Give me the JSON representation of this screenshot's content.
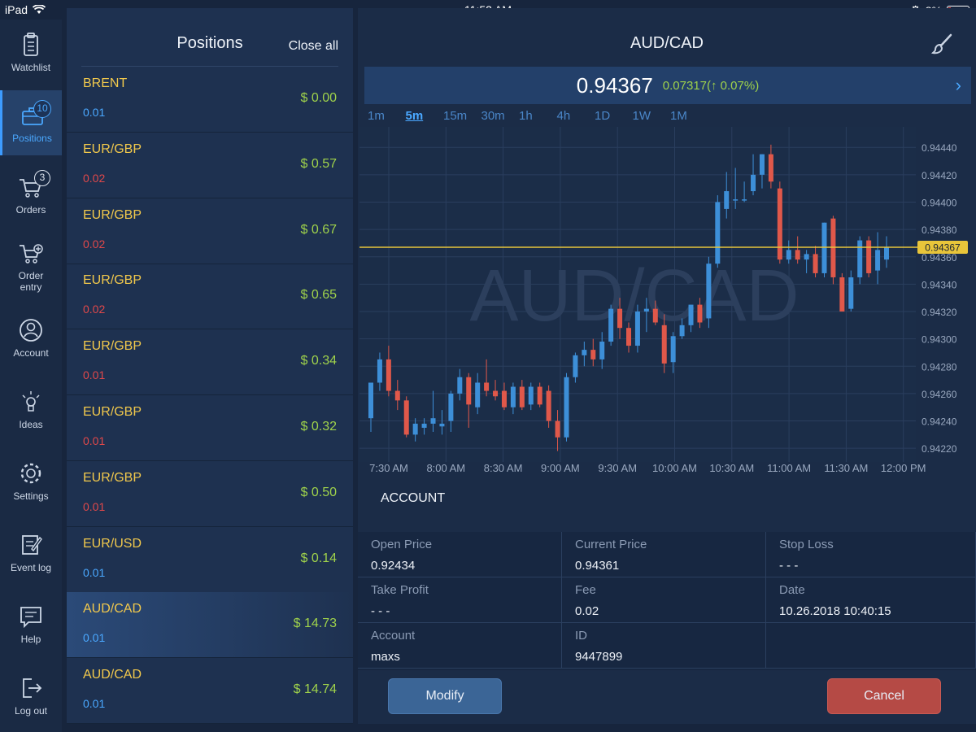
{
  "status": {
    "device": "iPad",
    "time": "11:52 AM",
    "battery": "8%"
  },
  "nav": [
    {
      "label": "Watchlist",
      "icon": "clipboard-icon"
    },
    {
      "label": "Positions",
      "icon": "briefcase-icon",
      "badge": "10"
    },
    {
      "label": "Orders",
      "icon": "cart-icon",
      "badge": "3"
    },
    {
      "label": "Order\nentry",
      "icon": "cart-plus-icon"
    },
    {
      "label": "Account",
      "icon": "user-icon"
    },
    {
      "label": "Ideas",
      "icon": "lightbulb-icon"
    },
    {
      "label": "Settings",
      "icon": "gear-icon"
    },
    {
      "label": "Event log",
      "icon": "edit-log-icon"
    },
    {
      "label": "Help",
      "icon": "chat-bubble-icon"
    },
    {
      "label": "Log out",
      "icon": "logout-icon"
    }
  ],
  "positions": {
    "title": "Positions",
    "close_all": "Close all",
    "rows": [
      {
        "symbol": "BRENT",
        "qty": "0.01",
        "qty_color": "#4aa8ff",
        "pnl": "$ 0.00"
      },
      {
        "symbol": "EUR/GBP",
        "qty": "0.02",
        "qty_color": "#e0484a",
        "pnl": "$ 0.57"
      },
      {
        "symbol": "EUR/GBP",
        "qty": "0.02",
        "qty_color": "#e0484a",
        "pnl": "$ 0.67"
      },
      {
        "symbol": "EUR/GBP",
        "qty": "0.02",
        "qty_color": "#e0484a",
        "pnl": "$ 0.65"
      },
      {
        "symbol": "EUR/GBP",
        "qty": "0.01",
        "qty_color": "#e0484a",
        "pnl": "$ 0.34"
      },
      {
        "symbol": "EUR/GBP",
        "qty": "0.01",
        "qty_color": "#e0484a",
        "pnl": "$ 0.32"
      },
      {
        "symbol": "EUR/GBP",
        "qty": "0.01",
        "qty_color": "#e0484a",
        "pnl": "$ 0.50"
      },
      {
        "symbol": "EUR/USD",
        "qty": "0.01",
        "qty_color": "#4aa8ff",
        "pnl": "$ 0.14"
      },
      {
        "symbol": "AUD/CAD",
        "qty": "0.01",
        "qty_color": "#4aa8ff",
        "pnl": "$ 14.73",
        "selected": true
      },
      {
        "symbol": "AUD/CAD",
        "qty": "0.01",
        "qty_color": "#4aa8ff",
        "pnl": "$ 14.74"
      }
    ]
  },
  "main": {
    "symbol": "AUD/CAD",
    "price": "0.94367",
    "change": "0.07317(↑ 0.07%)",
    "timeframes": [
      "1m",
      "5m",
      "15m",
      "30m",
      "1h",
      "4h",
      "1D",
      "1W",
      "1M"
    ],
    "active_timeframe": "5m",
    "account_title": "ACCOUNT",
    "details": [
      {
        "label": "Open Price",
        "value": "0.92434"
      },
      {
        "label": "Current Price",
        "value": "0.94361"
      },
      {
        "label": "Stop Loss",
        "value": "- - -"
      },
      {
        "label": "Take Profit",
        "value": "- - -"
      },
      {
        "label": "Fee",
        "value": "0.02"
      },
      {
        "label": "Date",
        "value": "10.26.2018 10:40:15"
      },
      {
        "label": "Account",
        "value": "maxs"
      },
      {
        "label": "ID",
        "value": "9447899"
      },
      {
        "label": "",
        "value": ""
      }
    ],
    "modify_label": "Modify",
    "cancel_label": "Cancel"
  },
  "chart_data": {
    "type": "candlestick",
    "watermark": "AUD/CAD",
    "x_ticks": [
      "7:30 AM",
      "8:00 AM",
      "8:30 AM",
      "9:00 AM",
      "9:30 AM",
      "10:00 AM",
      "10:30 AM",
      "11:00 AM",
      "11:30 AM",
      "12:00 PM"
    ],
    "y_ticks": [
      "0.94440",
      "0.94420",
      "0.94400",
      "0.94380",
      "0.94360",
      "0.94340",
      "0.94320",
      "0.94300",
      "0.94280",
      "0.94260",
      "0.94240",
      "0.94220"
    ],
    "ylim": [
      0.9421,
      0.94455
    ],
    "current_price_label": "0.94367",
    "current_price": 0.94367,
    "up_color": "#3d8fd8",
    "down_color": "#e0584a",
    "grid": true,
    "candles": [
      {
        "o": 0.94242,
        "h": 0.94262,
        "l": 0.94232,
        "c": 0.94268
      },
      {
        "o": 0.94268,
        "h": 0.9429,
        "l": 0.94262,
        "c": 0.94285
      },
      {
        "o": 0.94285,
        "h": 0.94295,
        "l": 0.94258,
        "c": 0.94262
      },
      {
        "o": 0.94262,
        "h": 0.9427,
        "l": 0.94248,
        "c": 0.94255
      },
      {
        "o": 0.94255,
        "h": 0.94258,
        "l": 0.94228,
        "c": 0.9423
      },
      {
        "o": 0.9423,
        "h": 0.94242,
        "l": 0.94225,
        "c": 0.94238
      },
      {
        "o": 0.94235,
        "h": 0.94242,
        "l": 0.9423,
        "c": 0.94238
      },
      {
        "o": 0.94238,
        "h": 0.94262,
        "l": 0.94232,
        "c": 0.94242
      },
      {
        "o": 0.94236,
        "h": 0.94248,
        "l": 0.9423,
        "c": 0.94238
      },
      {
        "o": 0.9424,
        "h": 0.94262,
        "l": 0.94232,
        "c": 0.9426
      },
      {
        "o": 0.9426,
        "h": 0.94278,
        "l": 0.94255,
        "c": 0.94272
      },
      {
        "o": 0.94272,
        "h": 0.94275,
        "l": 0.94235,
        "c": 0.94252
      },
      {
        "o": 0.9425,
        "h": 0.94275,
        "l": 0.94245,
        "c": 0.94268
      },
      {
        "o": 0.94268,
        "h": 0.94285,
        "l": 0.94258,
        "c": 0.94262
      },
      {
        "o": 0.94262,
        "h": 0.9427,
        "l": 0.94255,
        "c": 0.94258
      },
      {
        "o": 0.94262,
        "h": 0.94268,
        "l": 0.94248,
        "c": 0.9425
      },
      {
        "o": 0.9425,
        "h": 0.94268,
        "l": 0.94245,
        "c": 0.94265
      },
      {
        "o": 0.94265,
        "h": 0.9427,
        "l": 0.94248,
        "c": 0.9425
      },
      {
        "o": 0.94252,
        "h": 0.94268,
        "l": 0.94248,
        "c": 0.94265
      },
      {
        "o": 0.94265,
        "h": 0.94268,
        "l": 0.9425,
        "c": 0.94252
      },
      {
        "o": 0.94262,
        "h": 0.94266,
        "l": 0.94235,
        "c": 0.9424
      },
      {
        "o": 0.9424,
        "h": 0.94248,
        "l": 0.94218,
        "c": 0.94228
      },
      {
        "o": 0.94228,
        "h": 0.94275,
        "l": 0.94225,
        "c": 0.94272
      },
      {
        "o": 0.94272,
        "h": 0.9429,
        "l": 0.94268,
        "c": 0.94288
      },
      {
        "o": 0.94288,
        "h": 0.94298,
        "l": 0.9428,
        "c": 0.94292
      },
      {
        "o": 0.94292,
        "h": 0.943,
        "l": 0.9428,
        "c": 0.94285
      },
      {
        "o": 0.94285,
        "h": 0.94305,
        "l": 0.94278,
        "c": 0.94298
      },
      {
        "o": 0.94298,
        "h": 0.94325,
        "l": 0.94295,
        "c": 0.94322
      },
      {
        "o": 0.94322,
        "h": 0.9433,
        "l": 0.943,
        "c": 0.94308
      },
      {
        "o": 0.94308,
        "h": 0.94312,
        "l": 0.9429,
        "c": 0.94295
      },
      {
        "o": 0.94295,
        "h": 0.94325,
        "l": 0.9429,
        "c": 0.9432
      },
      {
        "o": 0.9432,
        "h": 0.9433,
        "l": 0.94305,
        "c": 0.94322
      },
      {
        "o": 0.94322,
        "h": 0.94328,
        "l": 0.9431,
        "c": 0.94312
      },
      {
        "o": 0.9431,
        "h": 0.94318,
        "l": 0.94275,
        "c": 0.94282
      },
      {
        "o": 0.94283,
        "h": 0.94305,
        "l": 0.94275,
        "c": 0.94302
      },
      {
        "o": 0.94302,
        "h": 0.94315,
        "l": 0.943,
        "c": 0.9431
      },
      {
        "o": 0.9431,
        "h": 0.94325,
        "l": 0.94305,
        "c": 0.94325
      },
      {
        "o": 0.94325,
        "h": 0.9433,
        "l": 0.94308,
        "c": 0.94312
      },
      {
        "o": 0.94315,
        "h": 0.9436,
        "l": 0.94308,
        "c": 0.94355
      },
      {
        "o": 0.94355,
        "h": 0.94405,
        "l": 0.94352,
        "c": 0.944
      },
      {
        "o": 0.94395,
        "h": 0.94422,
        "l": 0.94388,
        "c": 0.94408
      },
      {
        "o": 0.94402,
        "h": 0.94425,
        "l": 0.94395,
        "c": 0.94402
      },
      {
        "o": 0.94402,
        "h": 0.94415,
        "l": 0.944,
        "c": 0.94402
      },
      {
        "o": 0.94408,
        "h": 0.94435,
        "l": 0.94405,
        "c": 0.9442
      },
      {
        "o": 0.9442,
        "h": 0.94435,
        "l": 0.9441,
        "c": 0.94435
      },
      {
        "o": 0.94435,
        "h": 0.94442,
        "l": 0.9441,
        "c": 0.94415
      },
      {
        "o": 0.9441,
        "h": 0.94415,
        "l": 0.94355,
        "c": 0.94358
      },
      {
        "o": 0.94358,
        "h": 0.94372,
        "l": 0.94355,
        "c": 0.94365
      },
      {
        "o": 0.94365,
        "h": 0.94375,
        "l": 0.94355,
        "c": 0.94358
      },
      {
        "o": 0.94358,
        "h": 0.94365,
        "l": 0.94348,
        "c": 0.94362
      },
      {
        "o": 0.94362,
        "h": 0.94368,
        "l": 0.94345,
        "c": 0.94348
      },
      {
        "o": 0.94348,
        "h": 0.94385,
        "l": 0.94345,
        "c": 0.94385
      },
      {
        "o": 0.94388,
        "h": 0.9439,
        "l": 0.9434,
        "c": 0.94345
      },
      {
        "o": 0.94345,
        "h": 0.94348,
        "l": 0.9432,
        "c": 0.9432
      },
      {
        "o": 0.94322,
        "h": 0.9435,
        "l": 0.9432,
        "c": 0.94345
      },
      {
        "o": 0.94345,
        "h": 0.94375,
        "l": 0.9434,
        "c": 0.94372
      },
      {
        "o": 0.94372,
        "h": 0.94375,
        "l": 0.94345,
        "c": 0.94348
      },
      {
        "o": 0.9435,
        "h": 0.94378,
        "l": 0.9434,
        "c": 0.94365
      },
      {
        "o": 0.94358,
        "h": 0.94375,
        "l": 0.94352,
        "c": 0.94367
      }
    ]
  }
}
